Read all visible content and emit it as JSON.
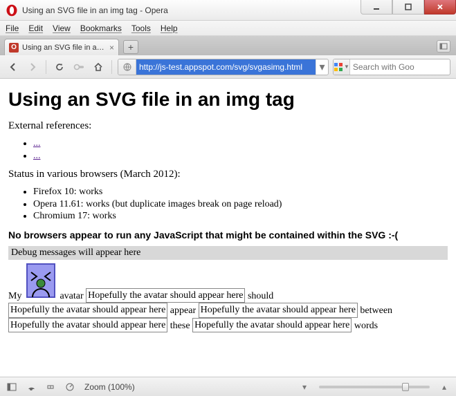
{
  "window": {
    "title": "Using an SVG file in an img tag - Opera"
  },
  "menu": {
    "file": "File",
    "edit": "Edit",
    "view": "View",
    "bookmarks": "Bookmarks",
    "tools": "Tools",
    "help": "Help"
  },
  "tab": {
    "title": "Using an SVG file in an ..."
  },
  "address": {
    "url": "http://js-test.appspot.com/svg/svgasimg.html"
  },
  "search": {
    "placeholder": "Search with Goo"
  },
  "page": {
    "h1": "Using an SVG file in an img tag",
    "external_refs_label": "External references:",
    "ref_links": [
      "...",
      "..."
    ],
    "status_label": "Status in various browsers (March 2012):",
    "status_items": [
      "Firefox 10: works",
      "Opera 11.61: works (but duplicate images break on page reload)",
      "Chromium 17: works"
    ],
    "no_js_line": "No browsers appear to run any JavaScript that might be contained within the SVG :-(",
    "debug_line": "Debug messages will appear here",
    "flow": {
      "w_my": "My",
      "w_avatar": "avatar",
      "w_should": "should",
      "w_appear": "appear",
      "w_between": "between",
      "w_these": "these",
      "w_words": "words",
      "box_text": "Hopefully the avatar should appear here"
    }
  },
  "status": {
    "zoom_label": "Zoom (100%)",
    "zoom_value_percent": 100
  }
}
